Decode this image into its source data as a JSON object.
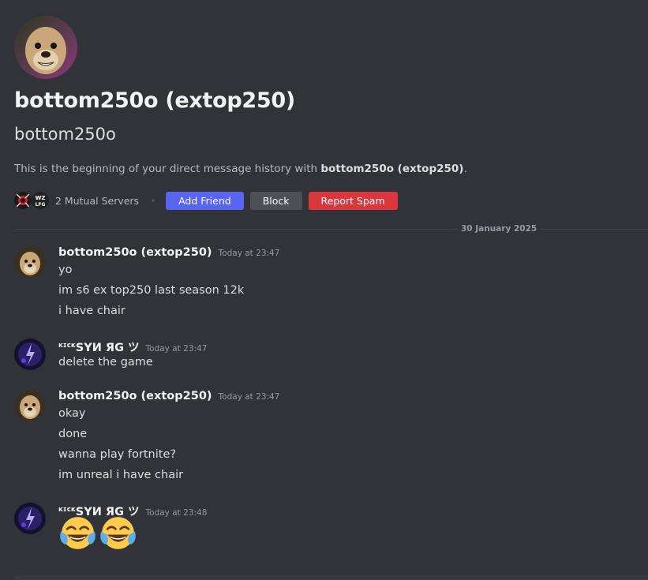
{
  "profile": {
    "display_name": "bottom250o (extop250)",
    "username": "bottom250o",
    "intro_prefix": "This is the beginning of your direct message history with ",
    "intro_name": "bottom250o (extop250)",
    "intro_suffix": ".",
    "mutual_servers": "2 Mutual Servers",
    "server_icons": [
      "server-icon-red",
      "server-icon-wz"
    ]
  },
  "actions": {
    "add_friend": "Add Friend",
    "block": "Block",
    "report_spam": "Report Spam"
  },
  "divider": {
    "date": "30 January 2025"
  },
  "messages": [
    {
      "author": "bottom250o (extop250)",
      "timestamp": "Today at 23:47",
      "lines": [
        "yo",
        "im s6 ex top250 last season 12k",
        "i have chair"
      ]
    },
    {
      "author_prefix": "ĸɪcĸ",
      "author": "SYИ ЯG ツ",
      "timestamp": "Today at 23:47",
      "lines": [
        "delete the game"
      ]
    },
    {
      "author": "bottom250o (extop250)",
      "timestamp": "Today at 23:47",
      "lines": [
        "okay",
        "done",
        "wanna play fortnite?",
        "im unreal i have chair"
      ]
    },
    {
      "author_prefix": "ĸɪcĸ",
      "author": "SYИ ЯG ツ",
      "timestamp": "Today at 23:48",
      "emojis": [
        "😂",
        "😂"
      ]
    }
  ],
  "colors": {
    "background": "#313338",
    "primary": "#5865f2",
    "secondary": "#4e5058",
    "danger": "#da373c"
  }
}
